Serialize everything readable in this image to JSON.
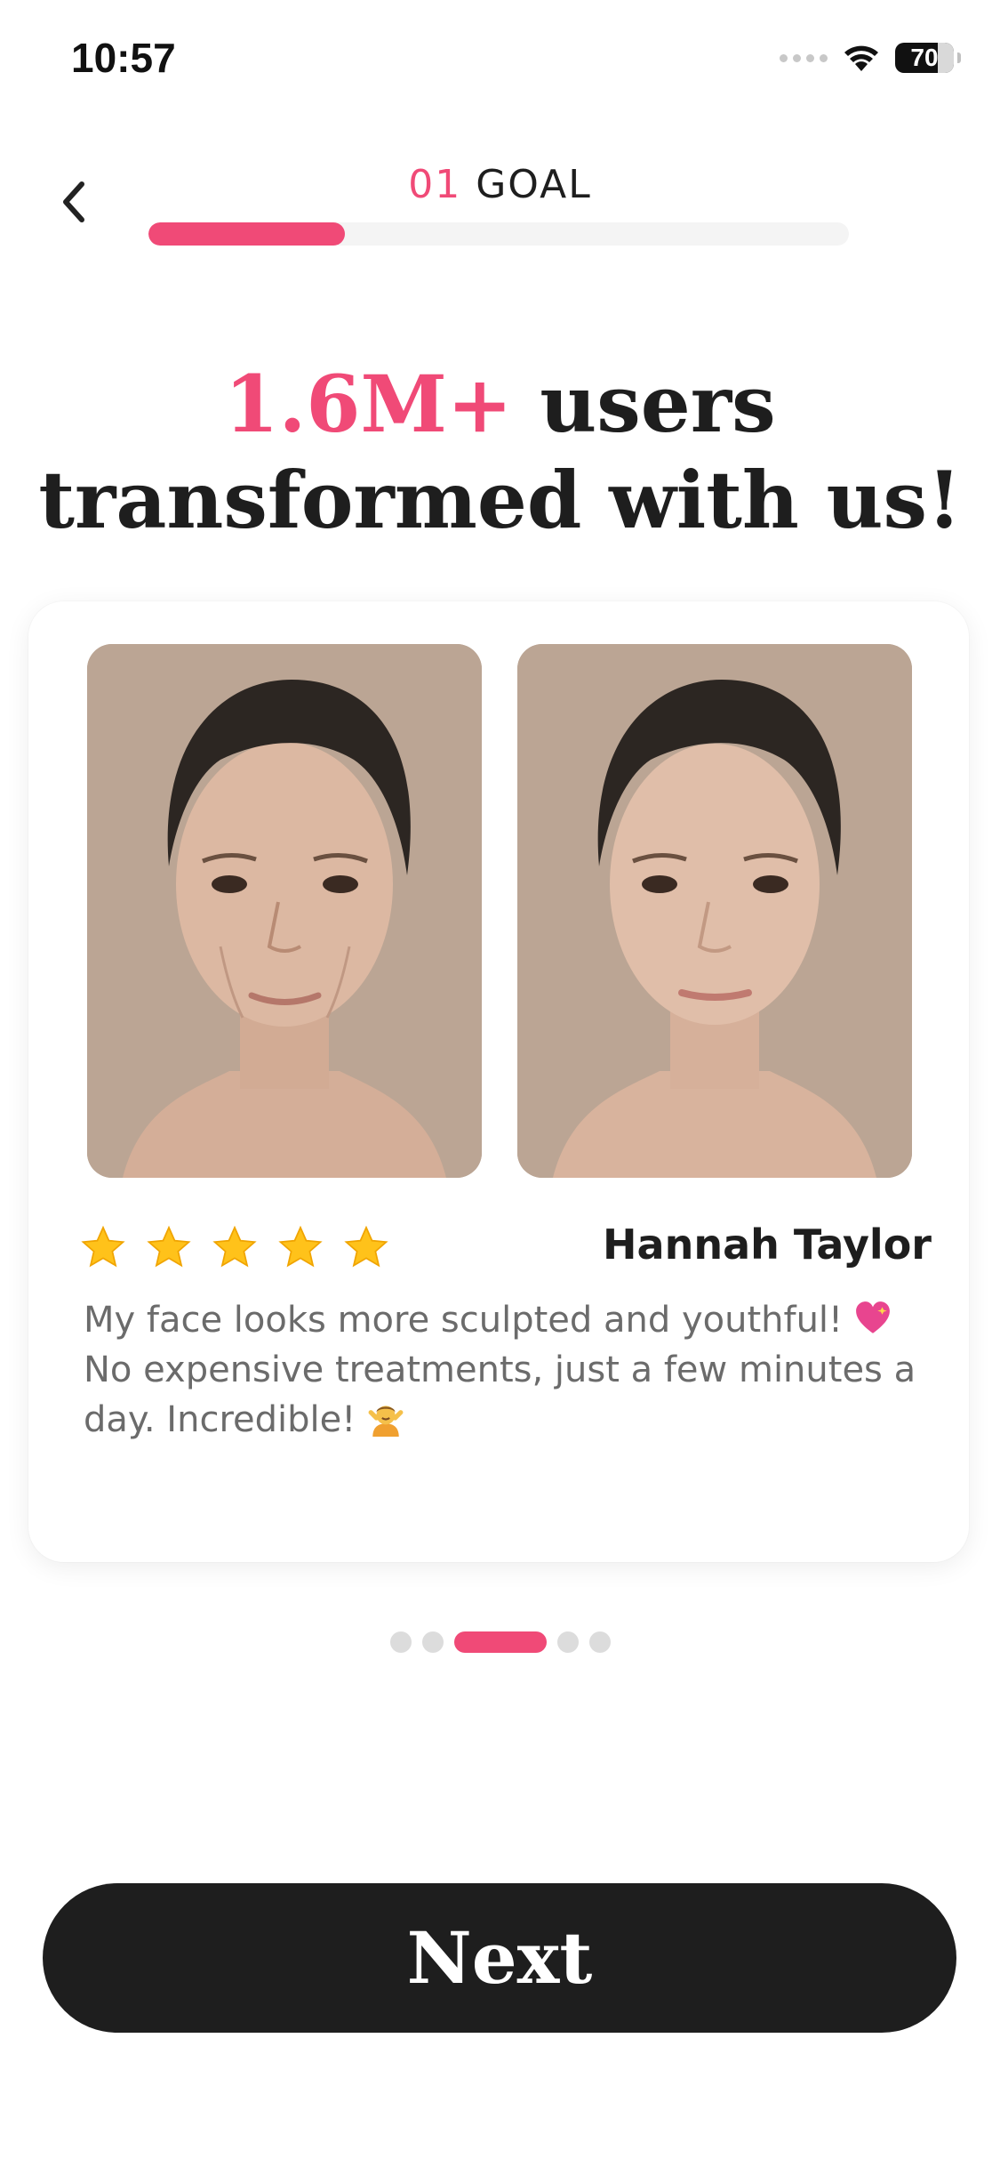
{
  "status_bar": {
    "time": "10:57",
    "battery": "70"
  },
  "header": {
    "step_number": "01",
    "step_title": "GOAL",
    "progress": 0.28
  },
  "headline": {
    "accent": "1.6M+",
    "line1_rest": " users",
    "line2": "transformed with us!"
  },
  "review": {
    "rating": 5,
    "name": "Hannah Taylor",
    "text_line1": "My face looks more sculpted and youthful! ",
    "text_line2": "No expensive treatments, just a few minutes a day. Incredible! ",
    "emoji_1": "sparkling-heart-icon",
    "emoji_2": "face-massage-icon"
  },
  "pager": {
    "count": 5,
    "active_index": 2
  },
  "next_button": {
    "label": "Next"
  },
  "colors": {
    "accent": "#f04a77",
    "dark": "#1e1e1e",
    "muted_text": "#6b6b6b"
  }
}
